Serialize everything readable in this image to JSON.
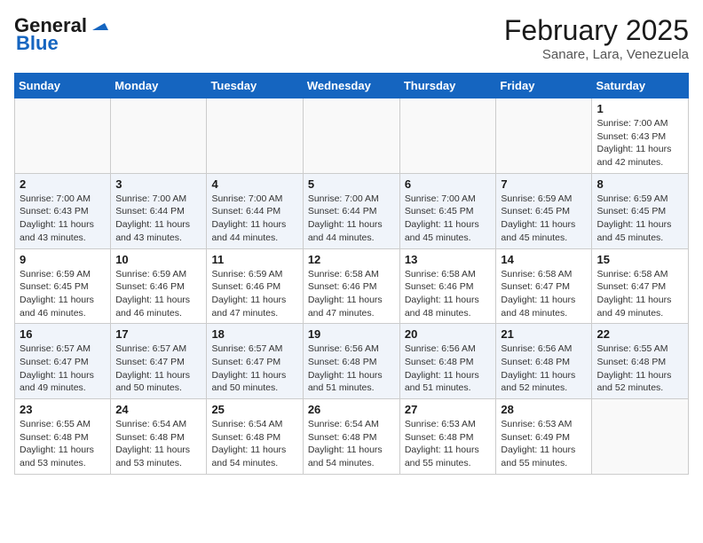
{
  "header": {
    "logo_general": "General",
    "logo_blue": "Blue",
    "month": "February 2025",
    "location": "Sanare, Lara, Venezuela"
  },
  "weekdays": [
    "Sunday",
    "Monday",
    "Tuesday",
    "Wednesday",
    "Thursday",
    "Friday",
    "Saturday"
  ],
  "weeks": [
    [
      {
        "day": "",
        "info": ""
      },
      {
        "day": "",
        "info": ""
      },
      {
        "day": "",
        "info": ""
      },
      {
        "day": "",
        "info": ""
      },
      {
        "day": "",
        "info": ""
      },
      {
        "day": "",
        "info": ""
      },
      {
        "day": "1",
        "info": "Sunrise: 7:00 AM\nSunset: 6:43 PM\nDaylight: 11 hours\nand 42 minutes."
      }
    ],
    [
      {
        "day": "2",
        "info": "Sunrise: 7:00 AM\nSunset: 6:43 PM\nDaylight: 11 hours\nand 43 minutes."
      },
      {
        "day": "3",
        "info": "Sunrise: 7:00 AM\nSunset: 6:44 PM\nDaylight: 11 hours\nand 43 minutes."
      },
      {
        "day": "4",
        "info": "Sunrise: 7:00 AM\nSunset: 6:44 PM\nDaylight: 11 hours\nand 44 minutes."
      },
      {
        "day": "5",
        "info": "Sunrise: 7:00 AM\nSunset: 6:44 PM\nDaylight: 11 hours\nand 44 minutes."
      },
      {
        "day": "6",
        "info": "Sunrise: 7:00 AM\nSunset: 6:45 PM\nDaylight: 11 hours\nand 45 minutes."
      },
      {
        "day": "7",
        "info": "Sunrise: 6:59 AM\nSunset: 6:45 PM\nDaylight: 11 hours\nand 45 minutes."
      },
      {
        "day": "8",
        "info": "Sunrise: 6:59 AM\nSunset: 6:45 PM\nDaylight: 11 hours\nand 45 minutes."
      }
    ],
    [
      {
        "day": "9",
        "info": "Sunrise: 6:59 AM\nSunset: 6:45 PM\nDaylight: 11 hours\nand 46 minutes."
      },
      {
        "day": "10",
        "info": "Sunrise: 6:59 AM\nSunset: 6:46 PM\nDaylight: 11 hours\nand 46 minutes."
      },
      {
        "day": "11",
        "info": "Sunrise: 6:59 AM\nSunset: 6:46 PM\nDaylight: 11 hours\nand 47 minutes."
      },
      {
        "day": "12",
        "info": "Sunrise: 6:58 AM\nSunset: 6:46 PM\nDaylight: 11 hours\nand 47 minutes."
      },
      {
        "day": "13",
        "info": "Sunrise: 6:58 AM\nSunset: 6:46 PM\nDaylight: 11 hours\nand 48 minutes."
      },
      {
        "day": "14",
        "info": "Sunrise: 6:58 AM\nSunset: 6:47 PM\nDaylight: 11 hours\nand 48 minutes."
      },
      {
        "day": "15",
        "info": "Sunrise: 6:58 AM\nSunset: 6:47 PM\nDaylight: 11 hours\nand 49 minutes."
      }
    ],
    [
      {
        "day": "16",
        "info": "Sunrise: 6:57 AM\nSunset: 6:47 PM\nDaylight: 11 hours\nand 49 minutes."
      },
      {
        "day": "17",
        "info": "Sunrise: 6:57 AM\nSunset: 6:47 PM\nDaylight: 11 hours\nand 50 minutes."
      },
      {
        "day": "18",
        "info": "Sunrise: 6:57 AM\nSunset: 6:47 PM\nDaylight: 11 hours\nand 50 minutes."
      },
      {
        "day": "19",
        "info": "Sunrise: 6:56 AM\nSunset: 6:48 PM\nDaylight: 11 hours\nand 51 minutes."
      },
      {
        "day": "20",
        "info": "Sunrise: 6:56 AM\nSunset: 6:48 PM\nDaylight: 11 hours\nand 51 minutes."
      },
      {
        "day": "21",
        "info": "Sunrise: 6:56 AM\nSunset: 6:48 PM\nDaylight: 11 hours\nand 52 minutes."
      },
      {
        "day": "22",
        "info": "Sunrise: 6:55 AM\nSunset: 6:48 PM\nDaylight: 11 hours\nand 52 minutes."
      }
    ],
    [
      {
        "day": "23",
        "info": "Sunrise: 6:55 AM\nSunset: 6:48 PM\nDaylight: 11 hours\nand 53 minutes."
      },
      {
        "day": "24",
        "info": "Sunrise: 6:54 AM\nSunset: 6:48 PM\nDaylight: 11 hours\nand 53 minutes."
      },
      {
        "day": "25",
        "info": "Sunrise: 6:54 AM\nSunset: 6:48 PM\nDaylight: 11 hours\nand 54 minutes."
      },
      {
        "day": "26",
        "info": "Sunrise: 6:54 AM\nSunset: 6:48 PM\nDaylight: 11 hours\nand 54 minutes."
      },
      {
        "day": "27",
        "info": "Sunrise: 6:53 AM\nSunset: 6:48 PM\nDaylight: 11 hours\nand 55 minutes."
      },
      {
        "day": "28",
        "info": "Sunrise: 6:53 AM\nSunset: 6:49 PM\nDaylight: 11 hours\nand 55 minutes."
      },
      {
        "day": "",
        "info": ""
      }
    ]
  ]
}
